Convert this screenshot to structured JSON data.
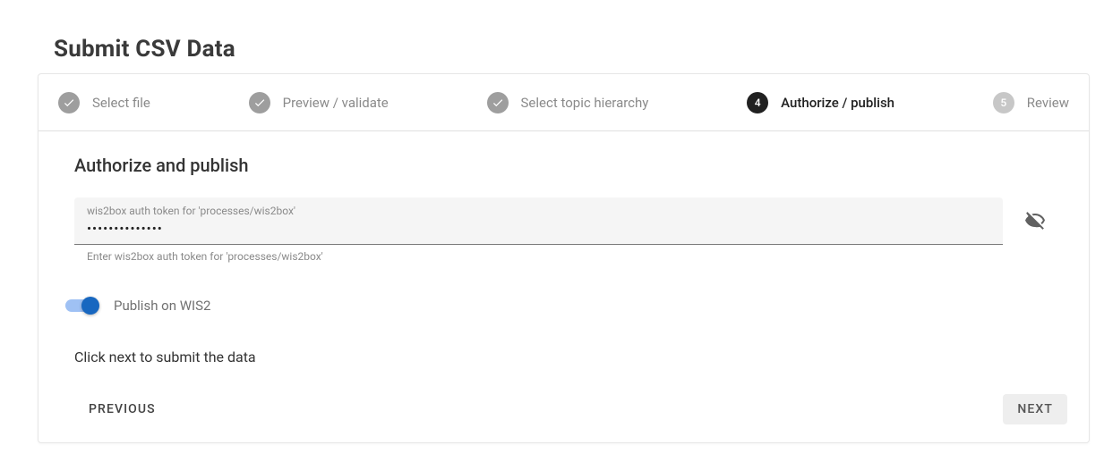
{
  "page_title": "Submit CSV Data",
  "stepper": {
    "steps": [
      {
        "label": "Select file",
        "state": "done"
      },
      {
        "label": "Preview / validate",
        "state": "done"
      },
      {
        "label": "Select topic hierarchy",
        "state": "done"
      },
      {
        "label": "Authorize / publish",
        "state": "active",
        "num": "4"
      },
      {
        "label": "Review",
        "state": "pending",
        "num": "5"
      }
    ]
  },
  "section": {
    "title": "Authorize and publish",
    "token_field": {
      "label": "wis2box auth token for 'processes/wis2box'",
      "value": "••••••••••••••",
      "hint": "Enter wis2box auth token for 'processes/wis2box'"
    },
    "publish_toggle": {
      "label": "Publish on WIS2",
      "on": true
    },
    "instruction": "Click next to submit the data"
  },
  "actions": {
    "previous": "Previous",
    "next": "Next"
  }
}
